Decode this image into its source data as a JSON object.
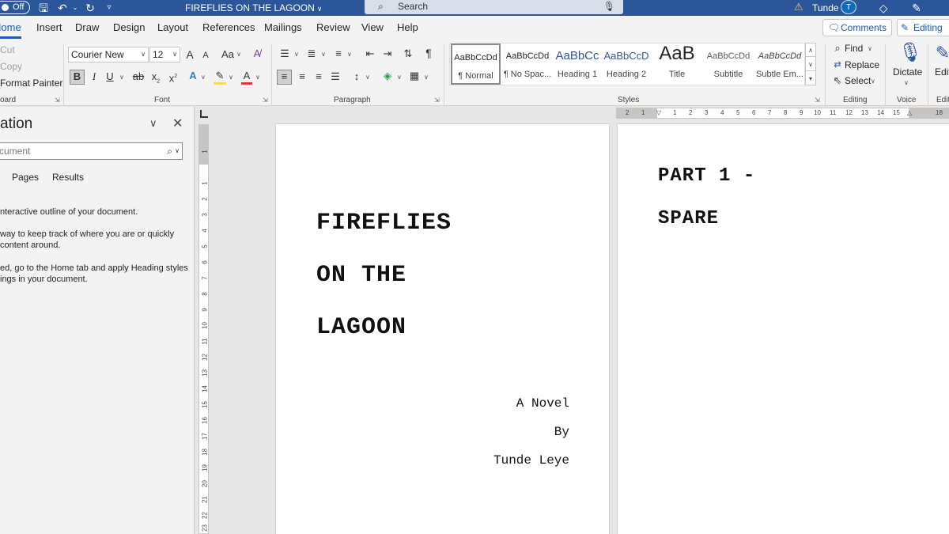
{
  "titlebar": {
    "autosave_label": "Off",
    "doc_title": "FIREFLIES ON THE LAGOON",
    "search_placeholder": "Search",
    "user_name": "Tunde",
    "avatar_initial": "T"
  },
  "tabs": [
    "Home",
    "Insert",
    "Draw",
    "Design",
    "Layout",
    "References",
    "Mailings",
    "Review",
    "View",
    "Help"
  ],
  "actions": {
    "comments_label": "Comments",
    "editing_label": "Editing"
  },
  "clipboard": {
    "cut": "Cut",
    "copy": "Copy",
    "format_painter": "Format Painter",
    "group_label": "Clipboard"
  },
  "font": {
    "family": "Courier New",
    "size": "12",
    "grow": "A",
    "shrink": "A",
    "change_case": "Aa",
    "bold": "B",
    "italic": "I",
    "underline": "U",
    "strike": "ab",
    "subscript": "x",
    "superscript": "x",
    "group_label": "Font"
  },
  "paragraph": {
    "pilcrow": "¶",
    "group_label": "Paragraph"
  },
  "styles": {
    "items": [
      {
        "preview": "AaBbCcDd",
        "name": "¶ Normal"
      },
      {
        "preview": "AaBbCcDd",
        "name": "¶ No Spac..."
      },
      {
        "preview": "AaBbCc",
        "name": "Heading 1"
      },
      {
        "preview": "AaBbCcD",
        "name": "Heading 2"
      },
      {
        "preview": "AaB",
        "name": "Title"
      },
      {
        "preview": "AaBbCcDd",
        "name": "Subtitle"
      },
      {
        "preview": "AaBbCcDd",
        "name": "Subtle Em..."
      }
    ],
    "group_label": "Styles"
  },
  "editing": {
    "find": "Find",
    "replace": "Replace",
    "select": "Select",
    "group_label": "Editing"
  },
  "voice": {
    "dictate": "Dictate",
    "group_label": "Voice"
  },
  "editor": {
    "label": "Edit",
    "group_label": "Edit"
  },
  "navigation": {
    "title": "ation",
    "search_placeholder": "cument",
    "tabs": [
      "Pages",
      "Results"
    ],
    "help_lines": [
      "nteractive outline of your document.",
      "way to keep track of where you are or quickly",
      "content around.",
      "ed, go to the Home tab and apply Heading styles",
      "ings in your document."
    ]
  },
  "vruler_numbers": [
    "1",
    "1",
    "2",
    "3",
    "4",
    "5",
    "6",
    "7",
    "8",
    "9",
    "10",
    "11",
    "12",
    "13",
    "14",
    "15",
    "16",
    "17",
    "18",
    "19",
    "20",
    "21",
    "22",
    "23"
  ],
  "hruler_numbers": [
    "2",
    "1",
    "1",
    "2",
    "3",
    "4",
    "5",
    "6",
    "7",
    "8",
    "9",
    "10",
    "11",
    "12",
    "13",
    "14",
    "15",
    "18"
  ],
  "document": {
    "page1": {
      "title_lines": [
        "FIREFLIES",
        "ON THE",
        "LAGOON"
      ],
      "byline": [
        "A Novel",
        "By",
        "Tunde Leye"
      ]
    },
    "page2": {
      "lines": [
        "PART 1 -",
        "SPARE"
      ]
    }
  }
}
